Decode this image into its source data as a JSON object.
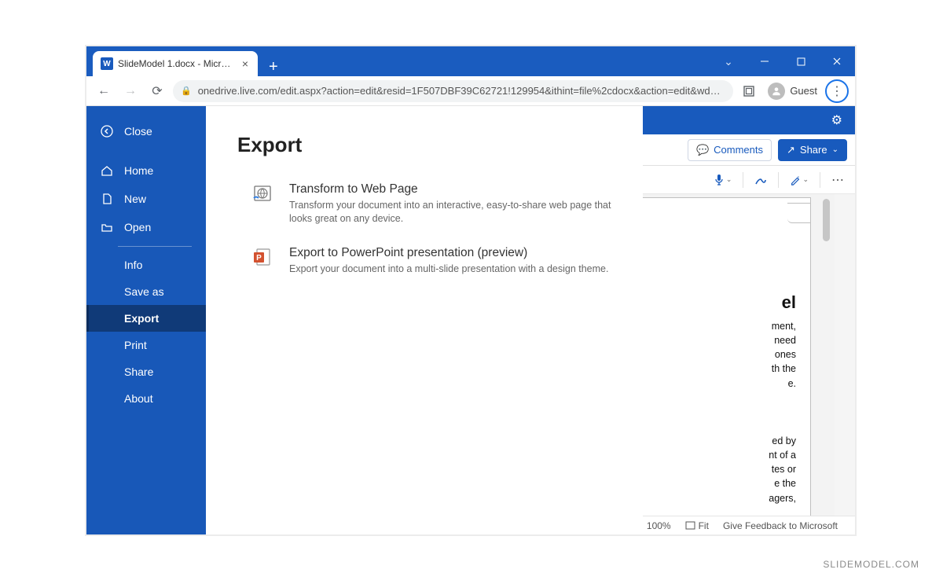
{
  "window": {
    "tab_title": "SlideModel 1.docx - Microsoft W",
    "url": "onedrive.live.com/edit.aspx?action=edit&resid=1F507DBF39C62721!129954&ithint=file%2cdocx&action=edit&wdNewAn...",
    "guest_label": "Guest"
  },
  "appbar": {
    "comments": "Comments",
    "share": "Share"
  },
  "sidebar": {
    "close": "Close",
    "home": "Home",
    "new": "New",
    "open": "Open",
    "items": [
      "Info",
      "Save as",
      "Export",
      "Print",
      "Share",
      "About"
    ],
    "active_index": 2
  },
  "main": {
    "title": "Export",
    "options": [
      {
        "title": "Transform to Web Page",
        "desc": "Transform your document into an interactive, easy-to-share web page that looks great on any device."
      },
      {
        "title": "Export to PowerPoint presentation (preview)",
        "desc": "Export your document into a multi-slide presentation with a design theme."
      }
    ]
  },
  "doc": {
    "heading_fragment": "el",
    "para1": "ment,\nneed\nones\nth the\ne.",
    "para2": "ed by\nnt of a\ntes or\ne the\nagers,"
  },
  "status": {
    "zoom": "100%",
    "fit": "Fit",
    "feedback": "Give Feedback to Microsoft"
  },
  "watermark": "SLIDEMODEL.COM"
}
